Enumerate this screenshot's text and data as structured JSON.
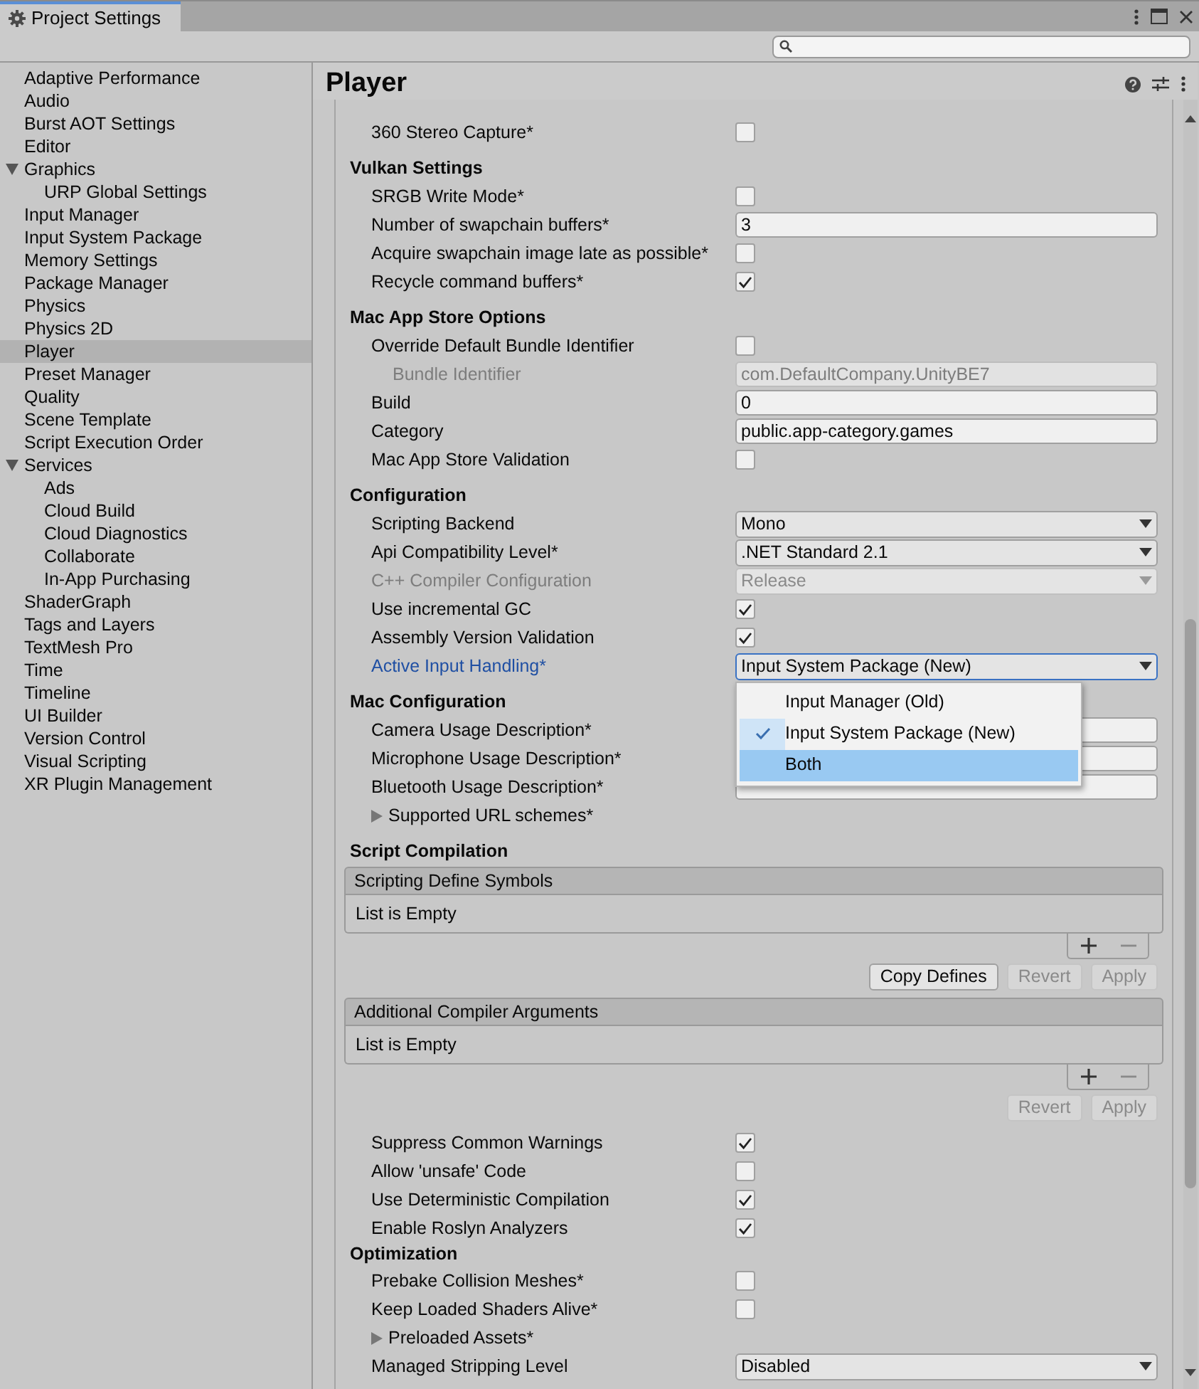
{
  "window": {
    "title": "Project Settings"
  },
  "sidebar": {
    "items": [
      {
        "label": "Adaptive Performance",
        "selected": false
      },
      {
        "label": "Audio",
        "selected": false
      },
      {
        "label": "Burst AOT Settings",
        "selected": false
      },
      {
        "label": "Editor",
        "selected": false
      },
      {
        "label": "Graphics",
        "selected": false,
        "expanded": true,
        "children": [
          {
            "label": "URP Global Settings",
            "selected": false
          }
        ]
      },
      {
        "label": "Input Manager",
        "selected": false
      },
      {
        "label": "Input System Package",
        "selected": false
      },
      {
        "label": "Memory Settings",
        "selected": false
      },
      {
        "label": "Package Manager",
        "selected": false
      },
      {
        "label": "Physics",
        "selected": false
      },
      {
        "label": "Physics 2D",
        "selected": false
      },
      {
        "label": "Player",
        "selected": true
      },
      {
        "label": "Preset Manager",
        "selected": false
      },
      {
        "label": "Quality",
        "selected": false
      },
      {
        "label": "Scene Template",
        "selected": false
      },
      {
        "label": "Script Execution Order",
        "selected": false
      },
      {
        "label": "Services",
        "selected": false,
        "expanded": true,
        "children": [
          {
            "label": "Ads",
            "selected": false
          },
          {
            "label": "Cloud Build",
            "selected": false
          },
          {
            "label": "Cloud Diagnostics",
            "selected": false
          },
          {
            "label": "Collaborate",
            "selected": false
          },
          {
            "label": "In-App Purchasing",
            "selected": false
          }
        ]
      },
      {
        "label": "ShaderGraph",
        "selected": false
      },
      {
        "label": "Tags and Layers",
        "selected": false
      },
      {
        "label": "TextMesh Pro",
        "selected": false
      },
      {
        "label": "Time",
        "selected": false
      },
      {
        "label": "Timeline",
        "selected": false
      },
      {
        "label": "UI Builder",
        "selected": false
      },
      {
        "label": "Version Control",
        "selected": false
      },
      {
        "label": "Visual Scripting",
        "selected": false
      },
      {
        "label": "XR Plugin Management",
        "selected": false
      }
    ]
  },
  "panel": {
    "title": "Player",
    "items": [
      {
        "kind": "checkbox",
        "label": "360 Stereo Capture*",
        "checked": false
      },
      {
        "kind": "heading",
        "label": "Vulkan Settings"
      },
      {
        "kind": "checkbox",
        "label": "SRGB Write Mode*",
        "checked": false
      },
      {
        "kind": "text",
        "label": "Number of swapchain buffers*",
        "value": "3"
      },
      {
        "kind": "checkbox",
        "label": "Acquire swapchain image late as possible*",
        "checked": false
      },
      {
        "kind": "checkbox",
        "label": "Recycle command buffers*",
        "checked": true
      },
      {
        "kind": "heading",
        "label": "Mac App Store Options"
      },
      {
        "kind": "checkbox",
        "label": "Override Default Bundle Identifier",
        "checked": false,
        "children": [
          {
            "kind": "text",
            "label": "Bundle Identifier",
            "value": "com.DefaultCompany.UnityBE7",
            "disabled": true
          }
        ]
      },
      {
        "kind": "text",
        "label": "Build",
        "value": "0"
      },
      {
        "kind": "text",
        "label": "Category",
        "value": "public.app-category.games"
      },
      {
        "kind": "checkbox",
        "label": "Mac App Store Validation",
        "checked": false
      },
      {
        "kind": "heading",
        "label": "Configuration"
      },
      {
        "kind": "dropdown",
        "label": "Scripting Backend",
        "value": "Mono"
      },
      {
        "kind": "dropdown",
        "label": "Api Compatibility Level*",
        "value": ".NET Standard 2.1"
      },
      {
        "kind": "dropdown",
        "label": "C++ Compiler Configuration",
        "value": "Release",
        "disabled": true
      },
      {
        "kind": "checkbox",
        "label": "Use incremental GC",
        "checked": true
      },
      {
        "kind": "checkbox",
        "label": "Assembly Version Validation",
        "checked": true
      },
      {
        "kind": "dropdown",
        "label": "Active Input Handling*",
        "value": "Input System Package (New)",
        "focused": true,
        "open": true,
        "options": [
          {
            "label": "Input Manager (Old)",
            "selected": false,
            "highlighted": false
          },
          {
            "label": "Input System Package (New)",
            "selected": true,
            "highlighted": false
          },
          {
            "label": "Both",
            "selected": false,
            "highlighted": true
          }
        ]
      },
      {
        "kind": "heading",
        "label": "Mac Configuration"
      },
      {
        "kind": "text",
        "label": "Camera Usage Description*"
      },
      {
        "kind": "text",
        "label": "Microphone Usage Description*"
      },
      {
        "kind": "text",
        "label": "Bluetooth Usage Description*"
      },
      {
        "kind": "foldout",
        "label": "Supported URL schemes*",
        "expanded": false
      },
      {
        "kind": "heading",
        "label": "Script Compilation"
      },
      {
        "kind": "list",
        "title": "Scripting Define Symbols",
        "empty_text": "List is Empty"
      },
      {
        "kind": "buttons",
        "buttons": [
          {
            "label": "Copy Defines",
            "disabled": false
          },
          {
            "label": "Revert",
            "disabled": true
          },
          {
            "label": "Apply",
            "disabled": true
          }
        ]
      },
      {
        "kind": "list",
        "title": "Additional Compiler Arguments",
        "empty_text": "List is Empty"
      },
      {
        "kind": "buttons",
        "buttons": [
          {
            "label": "Revert",
            "disabled": true
          },
          {
            "label": "Apply",
            "disabled": true
          }
        ]
      },
      {
        "kind": "checkbox",
        "label": "Suppress Common Warnings",
        "checked": true
      },
      {
        "kind": "checkbox",
        "label": "Allow 'unsafe' Code",
        "checked": false
      },
      {
        "kind": "checkbox",
        "label": "Use Deterministic Compilation",
        "checked": true
      },
      {
        "kind": "checkbox",
        "label": "Enable Roslyn Analyzers",
        "checked": true
      },
      {
        "kind": "heading",
        "label": "Optimization"
      },
      {
        "kind": "checkbox",
        "label": "Prebake Collision Meshes*",
        "checked": false
      },
      {
        "kind": "checkbox",
        "label": "Keep Loaded Shaders Alive*",
        "checked": false
      },
      {
        "kind": "foldout",
        "label": "Preloaded Assets*",
        "expanded": false
      },
      {
        "kind": "dropdown",
        "label": "Managed Stripping Level",
        "value": "Disabled"
      }
    ]
  }
}
